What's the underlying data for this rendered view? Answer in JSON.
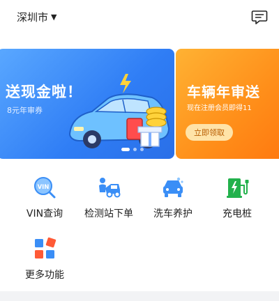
{
  "header": {
    "city": "深圳市",
    "caret": "▼",
    "message_icon": "message-icon"
  },
  "banners": [
    {
      "title": "送现金啦！",
      "subtitle": "8元年审券",
      "colors": [
        "#5aa8ff",
        "#2a6fe8"
      ],
      "art_icon": "car-gift-illustration"
    },
    {
      "title": "车辆年审送",
      "subtitle": "现在注册会员即得11",
      "button": "立即领取",
      "colors": [
        "#ffb233",
        "#ff7a10"
      ]
    }
  ],
  "carousel": {
    "active_index": 0,
    "count": 3
  },
  "features": [
    {
      "label": "VIN查询",
      "icon": "vin-search-icon",
      "color": "#3a8ef6"
    },
    {
      "label": "检测站下单",
      "icon": "car-repair-icon",
      "color": "#3a8ef6"
    },
    {
      "label": "洗车养护",
      "icon": "car-wash-icon",
      "color": "#3a8ef6"
    },
    {
      "label": "充电桩",
      "icon": "charging-pile-icon",
      "color": "#22b14c"
    },
    {
      "label": "更多功能",
      "icon": "more-apps-icon",
      "color": "#3a8ef6"
    }
  ],
  "colors": {
    "accent_blue": "#3a8ef6",
    "accent_orange": "#ff8f1a",
    "accent_green": "#22b14c",
    "text_primary": "#222222"
  }
}
